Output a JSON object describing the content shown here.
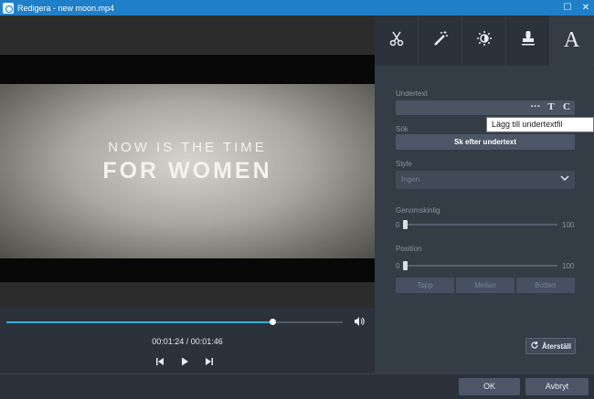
{
  "window": {
    "title": "Redigera - new moon.mp4",
    "maximize_glyph": "☐",
    "close_glyph": "✕"
  },
  "video": {
    "frame_line1": "NOW IS THE TIME",
    "frame_line2": "FOR WOMEN",
    "progress_fraction": 0.79,
    "time_text": "00:01:24 / 00:01:46"
  },
  "tabs": [
    {
      "icon": "scissors-icon",
      "glyph": "✂"
    },
    {
      "icon": "magic-wand-icon",
      "glyph": "⟋"
    },
    {
      "icon": "brightness-icon",
      "glyph": "☼"
    },
    {
      "icon": "stamp-icon",
      "glyph": "⊥"
    },
    {
      "icon": "text-icon",
      "glyph": "A",
      "active": true
    }
  ],
  "subtitle": {
    "label": "Undertext",
    "more_glyph": "···",
    "t_glyph": "T",
    "c_glyph": "C",
    "tooltip": "Lägg till undertextfil"
  },
  "search": {
    "label": "Sök",
    "button": "Sk efter undertext"
  },
  "style": {
    "label": "Style",
    "value": "Ingen"
  },
  "transparency": {
    "label": "Genomskinlig",
    "min": "0",
    "max": "100",
    "value": 0
  },
  "position": {
    "label": "Position",
    "min": "0",
    "max": "100",
    "value": 0,
    "segments": [
      "Topp",
      "Mellan",
      "Botten"
    ]
  },
  "reset_button": "Återställ",
  "footer": {
    "ok": "OK",
    "cancel": "Avbryt"
  },
  "colors": {
    "titlebar": "#1f7fc8",
    "accent": "#2fb0d8",
    "panel": "#343c46"
  }
}
